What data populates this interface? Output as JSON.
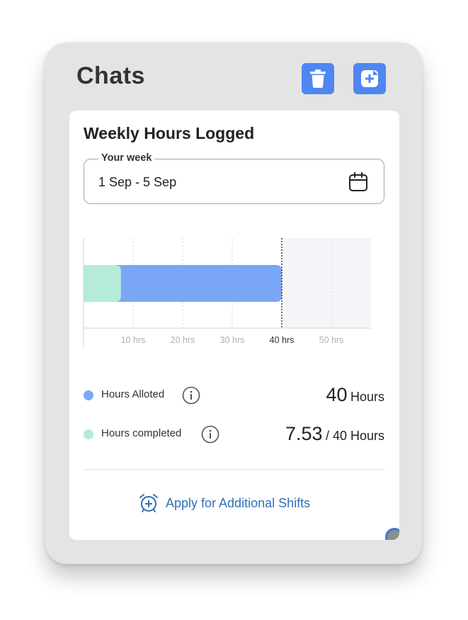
{
  "panel": {
    "title": "Chats",
    "delete_icon": "trash-icon",
    "new_chat_icon": "new-chat-plus-icon"
  },
  "card": {
    "title": "Weekly Hours Logged",
    "week_field": {
      "label": "Your week",
      "value": "1 Sep - 5 Sep",
      "icon": "calendar-icon"
    },
    "legend": [
      {
        "label": "Hours Alloted",
        "value": "40",
        "suffix": "Hours",
        "color": "#7aa7f5"
      },
      {
        "label": "Hours completed",
        "value": "7.53",
        "suffix": "/ 40 Hours",
        "color": "#b4ecd7"
      }
    ],
    "apply_label": "Apply for Additional Shifts"
  },
  "chart_data": {
    "type": "bar",
    "orientation": "horizontal",
    "series": [
      {
        "name": "Hours Alloted",
        "value": 40,
        "color": "#7aa7f5"
      },
      {
        "name": "Hours completed",
        "value": 7.53,
        "color": "#b4ecd7"
      }
    ],
    "x_ticks": [
      "10 hrs",
      "20 hrs",
      "30 hrs",
      "40 hrs",
      "50 hrs"
    ],
    "x_tick_values": [
      10,
      20,
      30,
      40,
      50
    ],
    "xlim": [
      0,
      58
    ],
    "highlight_tick": 40,
    "marker_line": 40,
    "shaded_range": [
      40,
      58
    ],
    "grid": "vertical dotted"
  }
}
